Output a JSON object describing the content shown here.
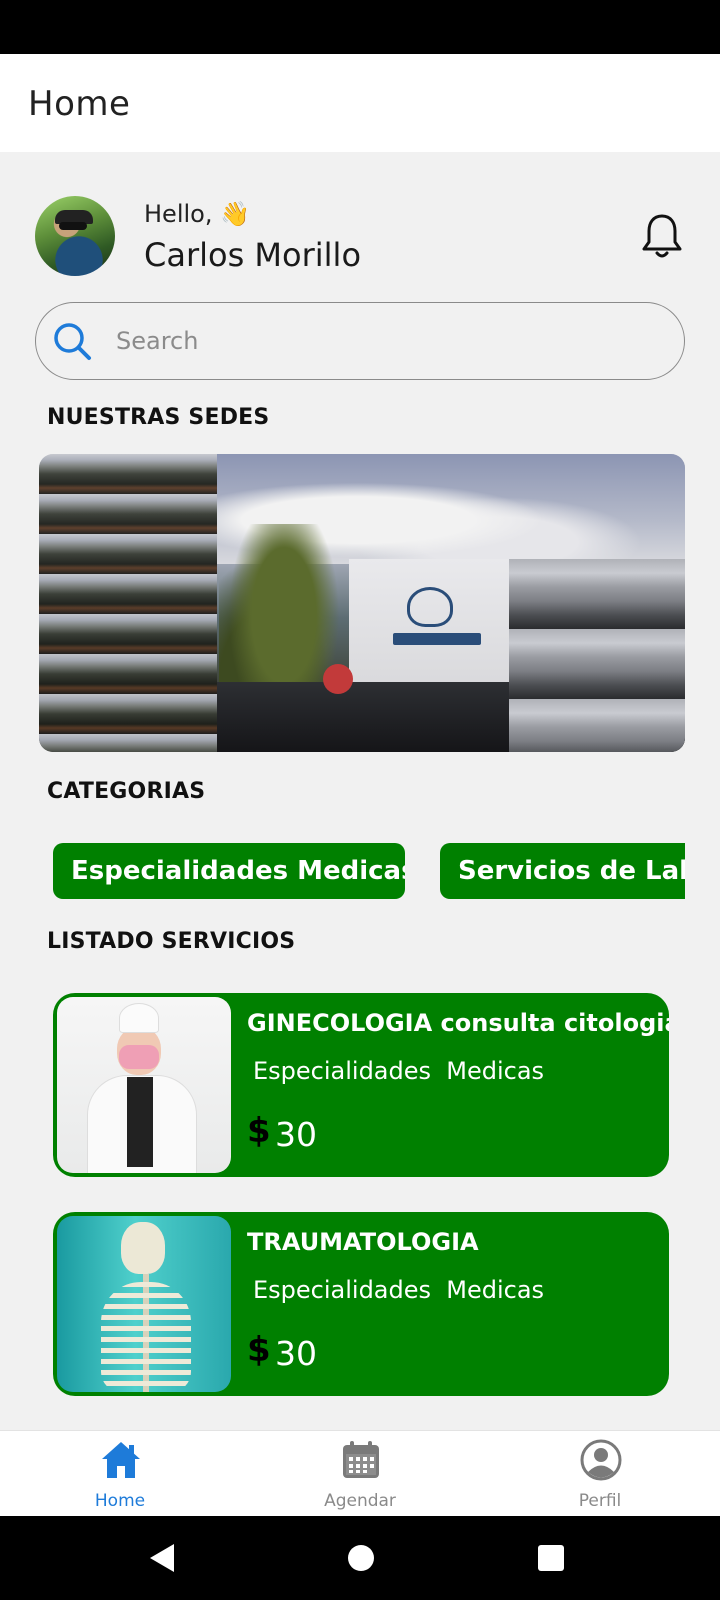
{
  "header": {
    "title": "Home"
  },
  "user": {
    "greeting": "Hello,",
    "wave_emoji": "👋",
    "name": "Carlos Morillo"
  },
  "search": {
    "placeholder": "Search",
    "value": ""
  },
  "sections": {
    "sedes_title": "NUESTRAS SEDES",
    "categories_title": "CATEGORIAS",
    "services_title": "LISTADO SERVICIOS"
  },
  "categories": [
    {
      "label": "Especialidades  Medicas"
    },
    {
      "label": "Servicios de Laboratorio"
    }
  ],
  "services": [
    {
      "title": "GINECOLOGIA consulta citologia y eco",
      "category": "Especialidades  Medicas",
      "currency": "$",
      "price": "30",
      "image": "doctor-woman-pink-mask"
    },
    {
      "title": "TRAUMATOLOGIA",
      "category": "Especialidades  Medicas",
      "currency": "$",
      "price": "30",
      "image": "skeleton-teal-background"
    }
  ],
  "bottom_nav": [
    {
      "label": "Home",
      "icon": "home-icon",
      "active": true
    },
    {
      "label": "Agendar",
      "icon": "calendar-icon",
      "active": false
    },
    {
      "label": "Perfil",
      "icon": "profile-icon",
      "active": false
    }
  ],
  "colors": {
    "accent_green": "#008000",
    "active_blue": "#1e7bd9",
    "inactive_gray": "#8a8a8a"
  }
}
